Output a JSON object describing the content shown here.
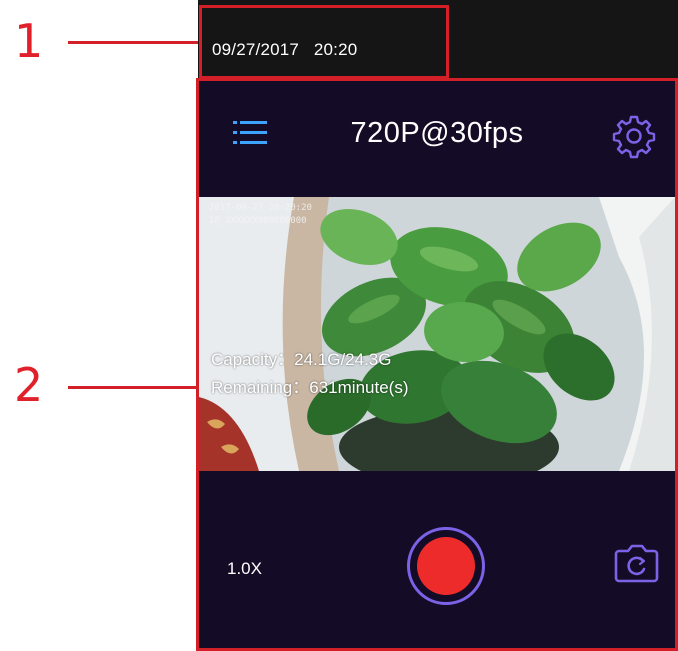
{
  "callouts": [
    {
      "number": "1"
    },
    {
      "number": "2"
    }
  ],
  "status_bar": {
    "date": "09/27/2017",
    "time": "20:20"
  },
  "header": {
    "menu_icon": "hamburger-menu-icon",
    "title": "720P@30fps",
    "settings_icon": "gear-icon"
  },
  "preview": {
    "osd_line1": "2017-09-27 20:20:20",
    "osd_line2": "IP_XXXXXX000000000",
    "capacity": "Capacity：24.1G/24.3G",
    "remaining": "Remaining：631minute(s)"
  },
  "controls": {
    "zoom": "1.0X",
    "record_icon": "record-icon",
    "camera_icon": "camera-switch-icon"
  },
  "colors": {
    "accent": "#7b63e8",
    "menu_icon": "#3ca3ff",
    "record": "#ee2b2b",
    "background": "#140c26",
    "callout": "#d31f27"
  }
}
